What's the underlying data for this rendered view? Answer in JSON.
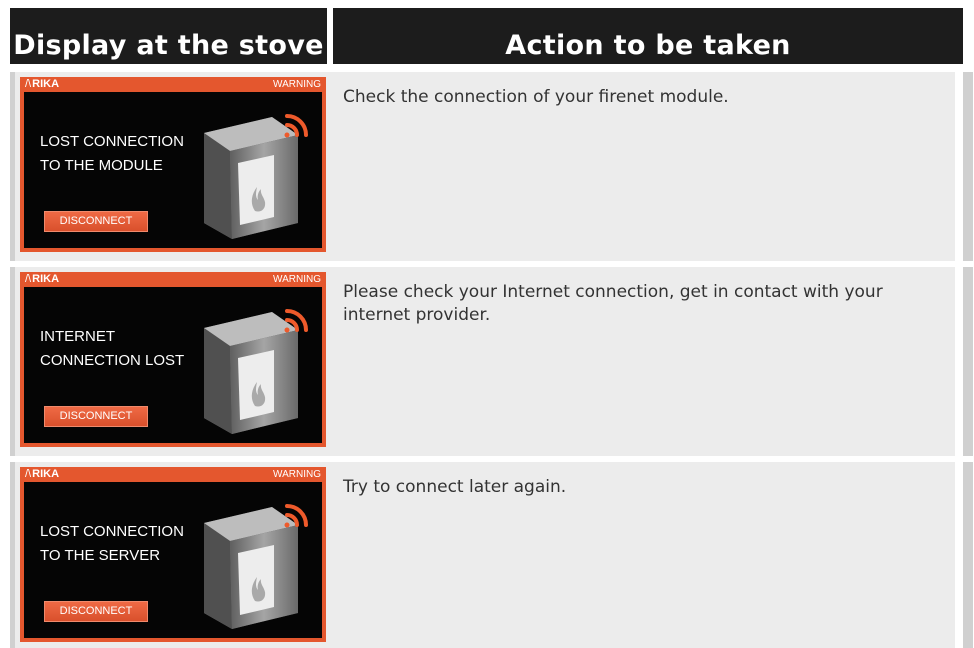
{
  "table": {
    "header_left": "Display at the stove",
    "header_right": "Action to be taken",
    "rows": [
      {
        "screen": {
          "brand": "RIKA",
          "badge": "WARNING",
          "line1": "LOST CONNECTION",
          "line2": "TO THE MODULE",
          "button": "DISCONNECT"
        },
        "action": "Check the connection of your firenet module."
      },
      {
        "screen": {
          "brand": "RIKA",
          "badge": "WARNING",
          "line1": "INTERNET",
          "line2": "CONNECTION LOST",
          "button": "DISCONNECT"
        },
        "action": "Please check your Internet connection, get in contact with your internet provider."
      },
      {
        "screen": {
          "brand": "RIKA",
          "badge": "WARNING",
          "line1": "LOST CONNECTION",
          "line2": "TO THE SERVER",
          "button": "DISCONNECT"
        },
        "action": "Try to connect later again."
      }
    ]
  },
  "colors": {
    "accent": "#e4572e",
    "header_bg": "#1c1c1c",
    "row_bg": "#ececec",
    "screen_bg": "#050505"
  },
  "icons": [
    "stove-icon",
    "wifi-icon",
    "flame-icon"
  ]
}
